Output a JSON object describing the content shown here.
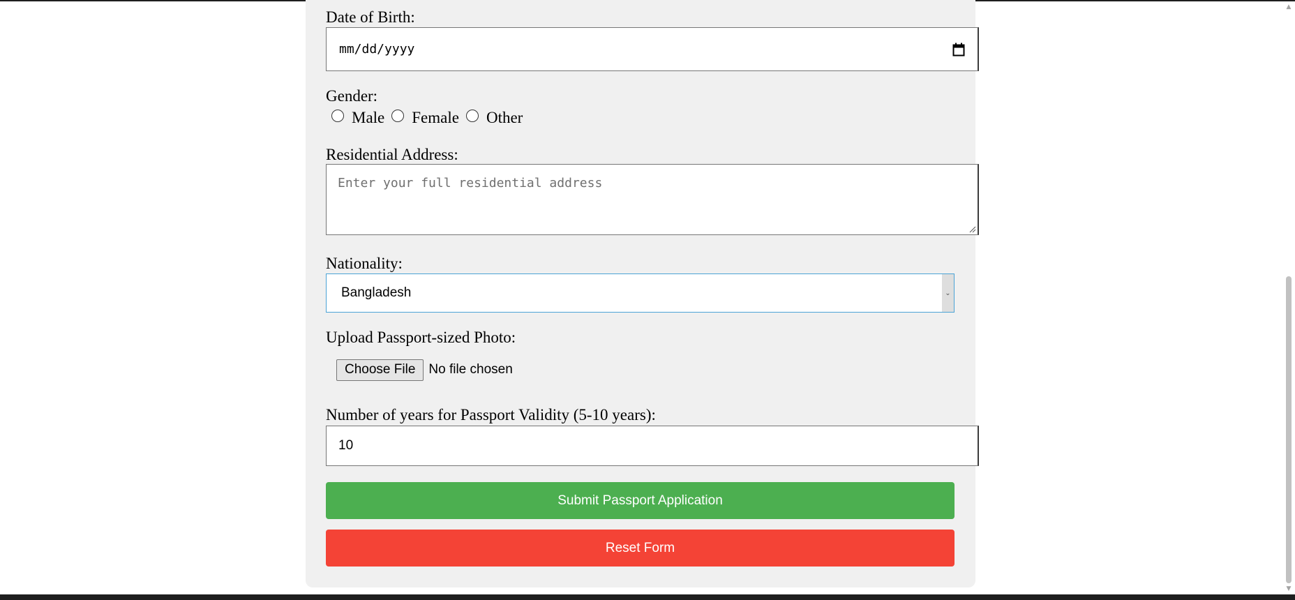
{
  "form": {
    "dob": {
      "label": "Date of Birth:",
      "placeholder": "mm/dd/yyyy"
    },
    "gender": {
      "label": "Gender:",
      "options": [
        "Male",
        "Female",
        "Other"
      ]
    },
    "address": {
      "label": "Residential Address:",
      "placeholder": "Enter your full residential address"
    },
    "nationality": {
      "label": "Nationality:",
      "selected": "Bangladesh"
    },
    "photo": {
      "label": "Upload Passport-sized Photo:",
      "button_label": "Choose File",
      "status": "No file chosen"
    },
    "validity": {
      "label": "Number of years for Passport Validity (5-10 years):",
      "value": "10"
    },
    "submit_label": "Submit Passport Application",
    "reset_label": "Reset Form"
  },
  "colors": {
    "card_background": "#f0f0f0",
    "submit_button": "#4caf50",
    "reset_button": "#f44336",
    "select_focus_border": "#4aa3d6"
  },
  "icons": {
    "date": "calendar-icon",
    "select": "chevron-down-icon",
    "textarea": "resize-grip-icon",
    "scroll_up": "scroll-up-arrow-icon",
    "scroll_down": "scroll-down-arrow-icon"
  }
}
